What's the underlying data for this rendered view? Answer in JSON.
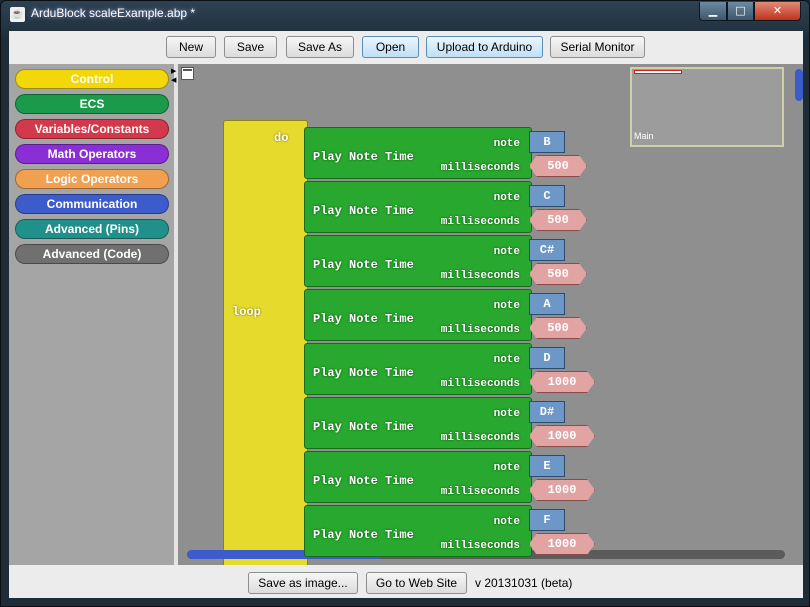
{
  "window": {
    "title": "ArduBlock scaleExample.abp *",
    "app_icon": "java-cup-icon",
    "min_glyph": "▁",
    "max_glyph": "□",
    "close_glyph": "✕"
  },
  "toolbar": {
    "new": "New",
    "save": "Save",
    "save_as": "Save As",
    "open": "Open",
    "upload": "Upload to Arduino",
    "serial_monitor": "Serial Monitor"
  },
  "palette": {
    "items": [
      {
        "label": "Control",
        "color": "#f2d70a"
      },
      {
        "label": "ECS",
        "color": "#1a9a4a"
      },
      {
        "label": "Variables/Constants",
        "color": "#d23a4c"
      },
      {
        "label": "Math Operators",
        "color": "#8a2fd6"
      },
      {
        "label": "Logic Operators",
        "color": "#f0a050"
      },
      {
        "label": "Communication",
        "color": "#3d5ccc"
      },
      {
        "label": "Advanced (Pins)",
        "color": "#22908a"
      },
      {
        "label": "Advanced (Code)",
        "color": "#707070"
      }
    ]
  },
  "canvas": {
    "minimap_label": "Main",
    "loop_label": "loop",
    "do_label": "do",
    "blocks": [
      {
        "title": "Play Note Time",
        "note_label": "note",
        "ms_label": "milliseconds",
        "note": "B",
        "ms": "500"
      },
      {
        "title": "Play Note Time",
        "note_label": "note",
        "ms_label": "milliseconds",
        "note": "C",
        "ms": "500"
      },
      {
        "title": "Play Note Time",
        "note_label": "note",
        "ms_label": "milliseconds",
        "note": "C#",
        "ms": "500"
      },
      {
        "title": "Play Note Time",
        "note_label": "note",
        "ms_label": "milliseconds",
        "note": "A",
        "ms": "500"
      },
      {
        "title": "Play Note Time",
        "note_label": "note",
        "ms_label": "milliseconds",
        "note": "D",
        "ms": "1000"
      },
      {
        "title": "Play Note Time",
        "note_label": "note",
        "ms_label": "milliseconds",
        "note": "D#",
        "ms": "1000"
      },
      {
        "title": "Play Note Time",
        "note_label": "note",
        "ms_label": "milliseconds",
        "note": "E",
        "ms": "1000"
      },
      {
        "title": "Play Note Time",
        "note_label": "note",
        "ms_label": "milliseconds",
        "note": "F",
        "ms": "1000"
      }
    ]
  },
  "footer": {
    "save_image": "Save as image...",
    "website": "Go to Web Site",
    "version": "v 20131031 (beta)"
  }
}
